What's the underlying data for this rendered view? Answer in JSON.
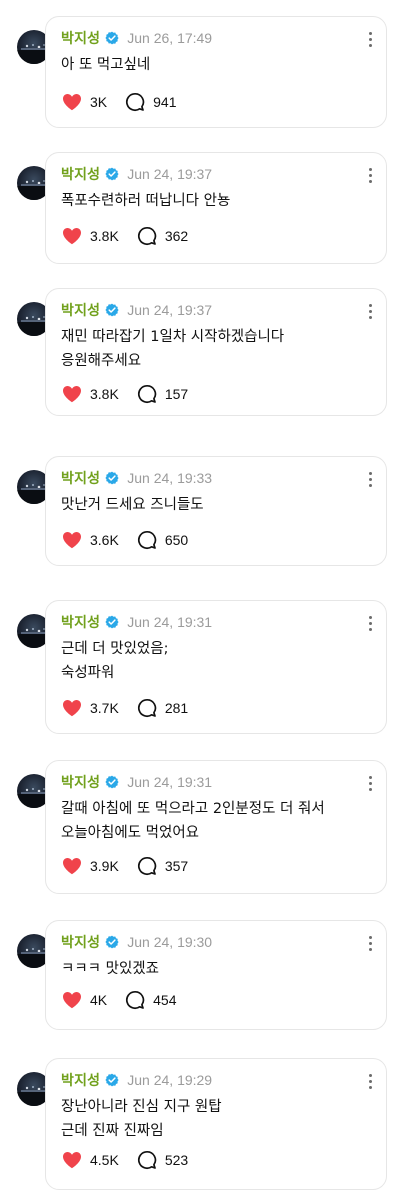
{
  "colors": {
    "name": "#71a11d",
    "heart": "#f0434b",
    "verified": "#2aa8e8"
  },
  "icons": {
    "like": "heart-icon",
    "comment": "comment-bubble-icon",
    "more": "more-vertical-icon",
    "badge": "verified-badge-icon"
  },
  "posts": [
    {
      "author": "박지성",
      "time": "Jun 26, 17:49",
      "lines": [
        "아 또 먹고싶네"
      ],
      "likes": "3K",
      "comments": "941"
    },
    {
      "author": "박지성",
      "time": "Jun 24, 19:37",
      "lines": [
        "폭포수련하러 떠납니다 안뇽"
      ],
      "likes": "3.8K",
      "comments": "362"
    },
    {
      "author": "박지성",
      "time": "Jun 24, 19:37",
      "lines": [
        "재민 따라잡기 1일차 시작하겠습니다",
        "응원해주세요"
      ],
      "likes": "3.8K",
      "comments": "157"
    },
    {
      "author": "박지성",
      "time": "Jun 24, 19:33",
      "lines": [
        "맛난거 드세요 즈니들도"
      ],
      "likes": "3.6K",
      "comments": "650"
    },
    {
      "author": "박지성",
      "time": "Jun 24, 19:31",
      "lines": [
        "근데 더 맛있었음;",
        "숙성파워"
      ],
      "likes": "3.7K",
      "comments": "281"
    },
    {
      "author": "박지성",
      "time": "Jun 24, 19:31",
      "lines": [
        "갈때 아침에 또 먹으라고 2인분정도 더 줘서",
        "오늘아침에도 먹었어요"
      ],
      "likes": "3.9K",
      "comments": "357"
    },
    {
      "author": "박지성",
      "time": "Jun 24, 19:30",
      "lines": [
        "ㅋㅋㅋ 맛있겠죠"
      ],
      "likes": "4K",
      "comments": "454"
    },
    {
      "author": "박지성",
      "time": "Jun 24, 19:29",
      "lines": [
        "장난아니라 진심 지구 원탑",
        "근데 진짜 진짜임"
      ],
      "likes": "4.5K",
      "comments": "523"
    }
  ]
}
